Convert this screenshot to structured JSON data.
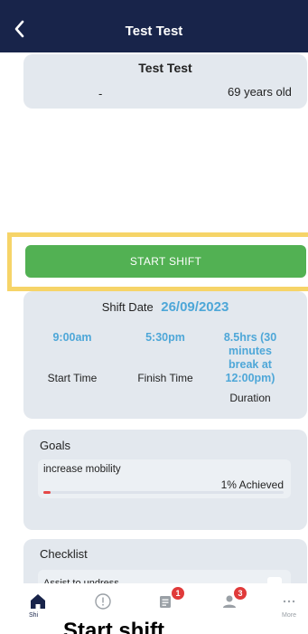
{
  "header": {
    "title": "Test Test"
  },
  "client": {
    "name": "Test Test",
    "dash": "-",
    "age": "69 years old"
  },
  "start_shift": {
    "label": "START SHIFT"
  },
  "shift": {
    "date_label": "Shift Date",
    "date_value": "26/09/2023",
    "start_time": "9:00am",
    "start_label": "Start Time",
    "finish_time": "5:30pm",
    "finish_label": "Finish Time",
    "duration_line1": "8.5hrs (30",
    "duration_line2": "minutes",
    "duration_line3": "break at",
    "duration_line4": "12:00pm)",
    "duration_label": "Duration"
  },
  "goals": {
    "title": "Goals",
    "items": [
      {
        "name": "increase mobility",
        "achieved_text": "1% Achieved",
        "progress": 0.03
      }
    ]
  },
  "checklist": {
    "title": "Checklist",
    "items": [
      {
        "label": "Assist to undress"
      }
    ]
  },
  "tabbar": {
    "items": [
      {
        "label": "Shi",
        "icon": "home-icon",
        "active": true
      },
      {
        "label": "",
        "icon": "info-icon"
      },
      {
        "label": "",
        "icon": "notes-icon",
        "badge": "1"
      },
      {
        "label": "",
        "icon": "person-icon",
        "badge": "3"
      },
      {
        "label": "More",
        "icon": "more-icon"
      }
    ]
  },
  "caption": "Start shift",
  "colors": {
    "header": "#18244a",
    "accent_blue": "#4ea7d8",
    "button_green": "#52b153",
    "highlight": "#f6d468",
    "badge_red": "#e03a3a",
    "card_bg": "#e3e8ee"
  }
}
